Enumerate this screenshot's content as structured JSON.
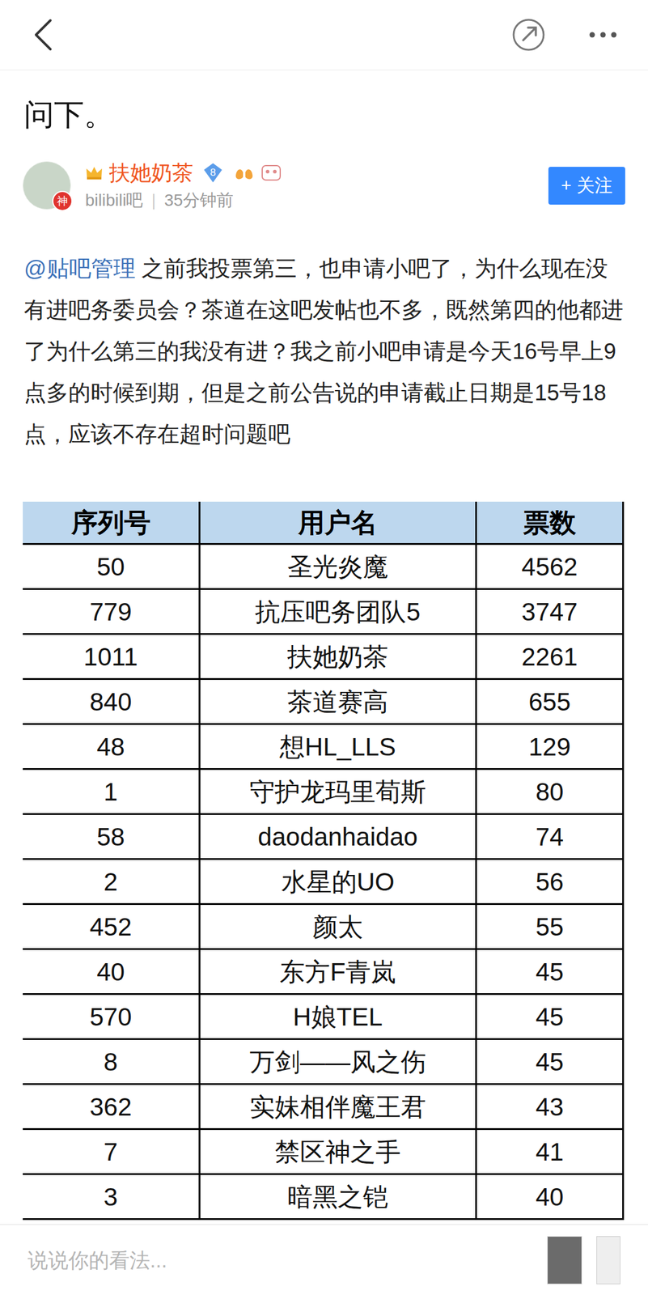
{
  "post": {
    "title": "问下。",
    "author": {
      "name": "扶她奶茶",
      "badge": "神",
      "level": "8",
      "forum": "bilibili吧",
      "separator": "|",
      "time": "35分钟前"
    },
    "follow_button": "+ 关注",
    "body": {
      "mention": "@贴吧管理",
      "text": " 之前我投票第三，也申请小吧了，为什么现在没有进吧务委员会？茶道在这吧发帖也不多，既然第四的他都进了为什么第三的我没有进？我之前小吧申请是今天16号早上9点多的时候到期，但是之前公告说的申请截止日期是15号18点，应该不存在超时问题吧"
    }
  },
  "table": {
    "columns": [
      "序列号",
      "用户名",
      "票数"
    ],
    "rows": [
      [
        "50",
        "圣光炎魔",
        "4562"
      ],
      [
        "779",
        "抗压吧务团队5",
        "3747"
      ],
      [
        "1011",
        "扶她奶茶",
        "2261"
      ],
      [
        "840",
        "茶道赛高",
        "655"
      ],
      [
        "48",
        "想HL_LLS",
        "129"
      ],
      [
        "1",
        "守护龙玛里荀斯",
        "80"
      ],
      [
        "58",
        "daodanhaidao",
        "74"
      ],
      [
        "2",
        "水星的UO",
        "56"
      ],
      [
        "452",
        "颜太",
        "55"
      ],
      [
        "40",
        "东方F青岚",
        "45"
      ],
      [
        "570",
        "H娘TEL",
        "45"
      ],
      [
        "8",
        "万剑——风之伤",
        "45"
      ],
      [
        "362",
        "实妹相伴魔王君",
        "43"
      ],
      [
        "7",
        "禁区神之手",
        "41"
      ],
      [
        "3",
        "暗黑之铠",
        "40"
      ]
    ]
  },
  "comment_bar": {
    "placeholder": "说说你的看法..."
  }
}
